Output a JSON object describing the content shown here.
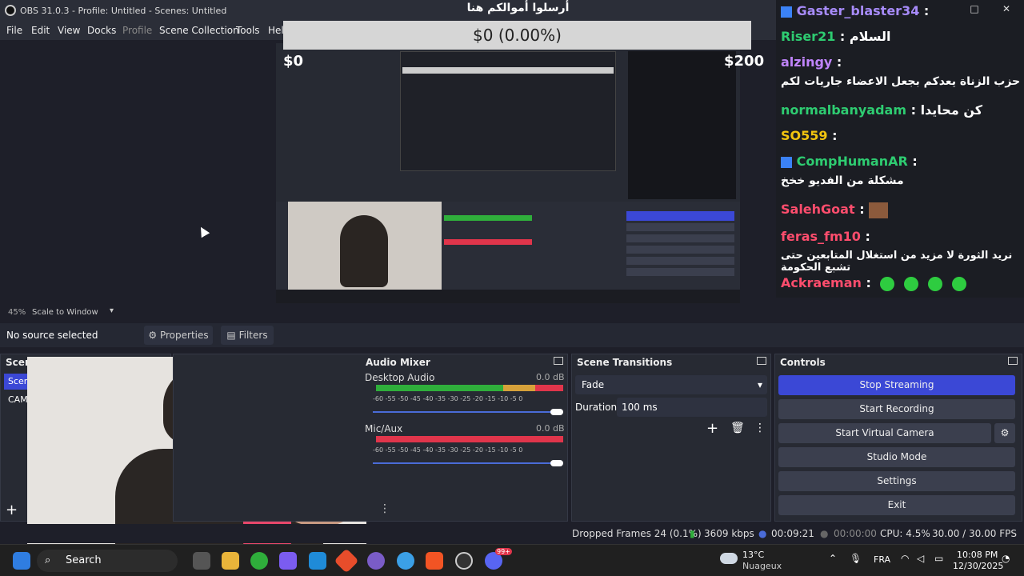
{
  "window": {
    "title": "OBS 31.0.3 - Profile: Untitled - Scenes: Untitled",
    "min": "–",
    "max": "□",
    "close": "✕"
  },
  "menu": [
    "File",
    "Edit",
    "View",
    "Docks",
    "Profile",
    "Scene Collection",
    "Tools",
    "Help"
  ],
  "donation": {
    "title": "أرسلوا أموالكم هنا",
    "progress": "$0 (0.00%)",
    "progress_fraction": 0,
    "min": "$0",
    "max": "$200"
  },
  "chat": [
    {
      "user": "Gaster_blaster34",
      "color": "#a78bfa",
      "msg": ""
    },
    {
      "user": "Riser21",
      "color": "#2ecc71",
      "msg": "السلام"
    },
    {
      "user": "alzingy",
      "color": "#c084fc",
      "msg": "حزب الزناة يعدكم بجعل الاعضاء جاريات لكم"
    },
    {
      "user": "normalbanyadam",
      "color": "#2ecc71",
      "msg": "كن محايدا"
    },
    {
      "user": "SO559",
      "color": "#f1c40f",
      "msg": ""
    },
    {
      "user": "CompHumanAR",
      "color": "#2ecc71",
      "msg": "مشكلة من الفديو خخخ"
    },
    {
      "user": "SalehGoat",
      "color": "#ff4d6d",
      "msg": ""
    },
    {
      "user": "feras_fm10",
      "color": "#ff4d6d",
      "msg": "نريد الثورة لا مزيد من استغلال المتابعين حتى تشبع الحكومة"
    },
    {
      "user": "Ackraeman",
      "color": "#ff4d6d",
      "msg": ""
    }
  ],
  "zoom": {
    "percent": "45%",
    "mode": "Scale to Window"
  },
  "source": {
    "status": "No source selected",
    "properties": "Properties",
    "filters": "Filters"
  },
  "scenes": {
    "title": "Scenes",
    "items": [
      "Scene",
      "CAM"
    ]
  },
  "mixer": {
    "title": "Audio Mixer",
    "channels": [
      {
        "name": "Desktop Audio",
        "db": "0.0 dB",
        "level": 0.85
      },
      {
        "name": "Mic/Aux",
        "db": "0.0 dB",
        "level": 1.0
      }
    ],
    "scale": "-60  -55  -50  -45  -40  -35  -30  -25  -20  -15  -10  -5  0"
  },
  "transitions": {
    "title": "Scene Transitions",
    "selected": "Fade",
    "duration_label": "Duration",
    "duration": "100 ms"
  },
  "controls": {
    "title": "Controls",
    "buttons": [
      "Stop Streaming",
      "Start Recording",
      "Start Virtual Camera",
      "Studio Mode",
      "Settings",
      "Exit"
    ]
  },
  "status": {
    "dropped": "Dropped Frames 24 (0.1%)",
    "kbps": "3609 kbps",
    "stream_time": "00:09:21",
    "rec_time": "00:00:00",
    "cpu": "CPU: 4.5%",
    "fps": "30.00 / 30.00 FPS"
  },
  "taskbar": {
    "search": "Search",
    "weather_temp": "13°C",
    "weather_desc": "Nuageux",
    "lang": "FRA",
    "time": "10:08 PM",
    "date": "12/30/2025",
    "badge": "99+"
  },
  "colors": {
    "accent": "#3b48d6",
    "panel": "#272a33",
    "bg": "#1e1f29",
    "meter_green": "#2fae3b",
    "meter_red": "#e0354b"
  }
}
